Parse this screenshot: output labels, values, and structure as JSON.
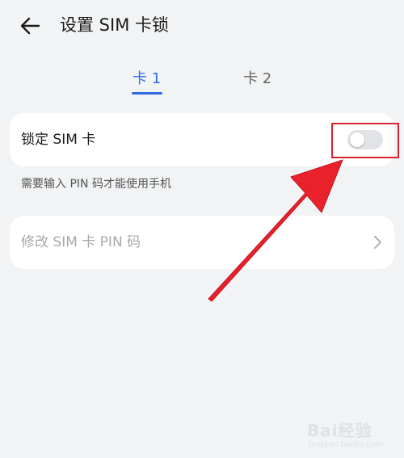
{
  "header": {
    "title": "设置 SIM 卡锁"
  },
  "tabs": [
    {
      "label": "卡 1",
      "active": true
    },
    {
      "label": "卡 2",
      "active": false
    }
  ],
  "lock_sim": {
    "label": "锁定 SIM 卡",
    "enabled": false,
    "hint": "需要输入 PIN 码才能使用手机"
  },
  "change_pin": {
    "label": "修改 SIM 卡 PIN 码"
  },
  "watermark": {
    "text": "Bai经验",
    "sub": "jingyan.baidu.com"
  },
  "colors": {
    "accent": "#2d6be6",
    "annotation": "#d8232a",
    "background": "#f1f3f5"
  }
}
